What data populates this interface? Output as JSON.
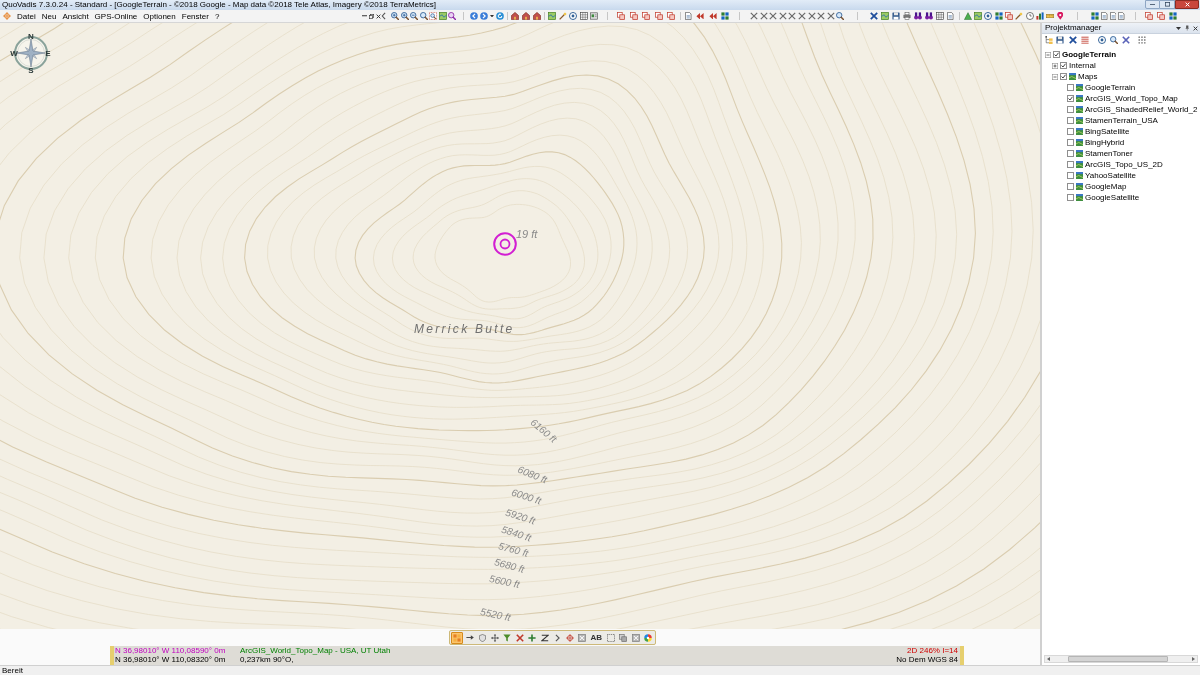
{
  "window": {
    "title": "QuoVadis 7.3.0.24 - Standard - [GoogleTerrain - ©2018 Google - Map data ©2018 Tele Atlas, Imagery ©2018 TerraMetrics]"
  },
  "menu": [
    "Datei",
    "Neu",
    "Ansicht",
    "GPS-Online",
    "Optionen",
    "Fenster",
    "?"
  ],
  "map": {
    "compass": [
      "N",
      "E",
      "S",
      "W"
    ],
    "elevation_label": "19 ft",
    "place_label": "Merrick Butte",
    "contour_labels": [
      "6160 ft",
      "6080 ft",
      "6000 ft",
      "5920 ft",
      "5840 ft",
      "5760 ft",
      "5680 ft",
      "5600 ft",
      "5520 ft"
    ]
  },
  "floating_toolbar": {
    "tools": [
      {
        "selected": true
      },
      {
        "selected": false
      },
      {
        "selected": false
      },
      {
        "selected": false
      },
      {
        "selected": false
      },
      {
        "selected": false
      },
      {
        "selected": false
      },
      {
        "selected": false
      },
      {
        "selected": false
      },
      {
        "selected": false
      },
      {
        "selected": false
      },
      {
        "selected": false,
        "label": "AB"
      },
      {
        "selected": false
      },
      {
        "selected": false
      },
      {
        "selected": false
      },
      {
        "selected": false
      }
    ]
  },
  "status_panel": {
    "rows": [
      {
        "coordinates": "N 36,98010° W 110,08590° 0m",
        "map_info": "ArcGIS_World_Topo_Map - USA, UT Utah",
        "view_info": "2D 246% I=14"
      },
      {
        "coordinates": "N 36,98010° W 110,08320° 0m",
        "map_info": "0,237km 90°O,",
        "view_info": "No Dem WGS 84"
      }
    ]
  },
  "project_manager": {
    "title": "Projektmanager",
    "tree": [
      {
        "label": "GoogleTerrain",
        "kind": "project",
        "checked": true,
        "expanded": true,
        "children": [
          {
            "label": "Internal",
            "kind": "folder",
            "checked": true,
            "expanded": false
          },
          {
            "label": "Maps",
            "kind": "map_folder",
            "checked": true,
            "expanded": true,
            "children": [
              {
                "label": "GoogleTerrain",
                "kind": "map",
                "checked": false
              },
              {
                "label": "ArcGIS_World_Topo_Map",
                "kind": "map",
                "checked": true
              },
              {
                "label": "ArcGIS_ShadedRelief_World_2",
                "kind": "map",
                "checked": false
              },
              {
                "label": "StamenTerrain_USA",
                "kind": "map",
                "checked": false
              },
              {
                "label": "BingSatellite",
                "kind": "map",
                "checked": false
              },
              {
                "label": "BingHybrid",
                "kind": "map",
                "checked": false
              },
              {
                "label": "StamenToner",
                "kind": "map",
                "checked": false
              },
              {
                "label": "ArcGIS_Topo_US_2D",
                "kind": "map",
                "checked": false
              },
              {
                "label": "YahooSatellite",
                "kind": "map",
                "checked": false
              },
              {
                "label": "GoogleMap",
                "kind": "map",
                "checked": false
              },
              {
                "label": "GoogleSatellite",
                "kind": "map",
                "checked": false
              }
            ]
          }
        ]
      }
    ]
  },
  "status_bar": {
    "text": "Bereit"
  }
}
